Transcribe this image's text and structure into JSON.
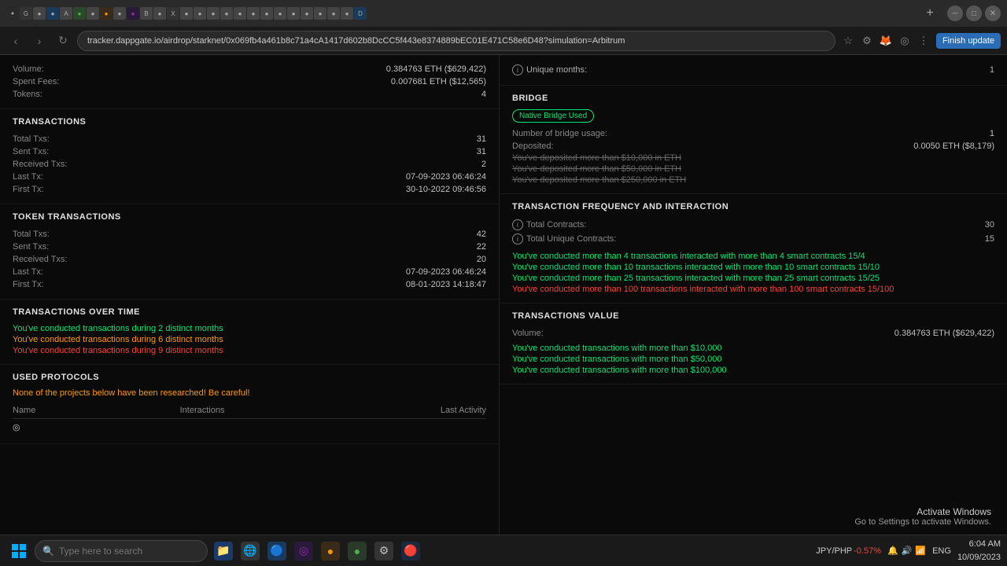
{
  "browser": {
    "tab_title": "tracker.dappgate.io/airdrop/starknet/0x069fb4a461b8c71a4cA1417d602b8DcCC5f443e8374889bEC01E471C58e6D48?simulation=Arbitrum",
    "address": "tracker.dappgate.io/airdrop/starknet/0x069fb4a461b8c71a4cA1417d602b8DcCC5f443e8374889bEC01E471C58e6D48?simulation=Arbitrum",
    "finish_update": "Finish update"
  },
  "left": {
    "volume_label": "Volume:",
    "volume_value": "0.384763 ETH ($629,422)",
    "spent_fees_label": "Spent Fees:",
    "spent_fees_value": "0.007681 ETH ($12,565)",
    "tokens_label": "Tokens:",
    "tokens_value": "4",
    "transactions_title": "TRANSACTIONS",
    "total_txs_label": "Total Txs:",
    "total_txs_value": "31",
    "sent_txs_label": "Sent Txs:",
    "sent_txs_value": "31",
    "received_txs_label": "Received Txs:",
    "received_txs_value": "2",
    "last_tx_label": "Last Tx:",
    "last_tx_value": "07-09-2023 06:46:24",
    "first_tx_label": "First Tx:",
    "first_tx_value": "30-10-2022 09:46:56",
    "token_transactions_title": "TOKEN TRANSACTIONS",
    "token_total_txs_label": "Total Txs:",
    "token_total_txs_value": "42",
    "token_sent_txs_label": "Sent Txs:",
    "token_sent_txs_value": "22",
    "token_received_txs_label": "Received Txs:",
    "token_received_txs_value": "20",
    "token_last_tx_label": "Last Tx:",
    "token_last_tx_value": "07-09-2023 06:46:24",
    "token_first_tx_label": "First Tx:",
    "token_first_tx_value": "08-01-2023 14:18:47",
    "over_time_title": "TRANSACTIONS OVER TIME",
    "over_time_1": "You've conducted transactions during 2 distinct months",
    "over_time_2": "You've conducted transactions during 6 distinct months",
    "over_time_3": "You've conducted transactions during 9 distinct months",
    "protocols_title": "USED PROTOCOLS",
    "protocols_warning": "None of the projects below have been researched! Be careful!",
    "protocols_col_name": "Name",
    "protocols_col_interactions": "Interactions",
    "protocols_col_last_activity": "Last Activity",
    "unique_months_label": "Unique months:",
    "unique_months_value": "1"
  },
  "right": {
    "bridge_title": "BRIDGE",
    "native_bridge_tag": "Native Bridge Used",
    "bridge_usage_label": "Number of bridge usage:",
    "bridge_usage_value": "1",
    "deposited_label": "Deposited:",
    "deposited_value": "0.0050 ETH ($8,179)",
    "bridge_msg_1": "You've deposited more than $10,000 in ETH",
    "bridge_msg_2": "You've deposited more than $50,000 in ETH",
    "bridge_msg_3": "You've deposited more than $250,000 in ETH",
    "tx_freq_title": "TRANSACTION FREQUENCY AND INTERACTION",
    "total_contracts_label": "Total Contracts:",
    "total_contracts_value": "30",
    "total_unique_contracts_label": "Total Unique Contracts:",
    "total_unique_contracts_value": "15",
    "freq_msg_1": "You've conducted more than 4 transactions\ninteracted with more than 4 smart contracts 15/4",
    "freq_msg_2": "You've conducted more than 10 transactions\ninteracted with more than 10 smart contracts 15/10",
    "freq_msg_3": "You've conducted more than 25 transactions\ninteracted with more than 25 smart contracts 15/25",
    "freq_msg_4": "You've conducted more than 100 transactions\ninteracted with more than 100 smart contracts 15/100",
    "tx_value_title": "TRANSACTIONS VALUE",
    "volume_label": "Volume:",
    "volume_value": "0.384763 ETH ($629,422)",
    "value_msg_1": "You've conducted transactions with more than $10,000",
    "value_msg_2": "You've conducted transactions with more than $50,000",
    "value_msg_3": "You've conducted transactions with more than $100,000"
  },
  "taskbar": {
    "search_placeholder": "Type here to search",
    "time": "6:04 AM",
    "date": "10/09/2023",
    "currency": "JPY/PHP",
    "currency_change": "-0.57%",
    "language": "ENG"
  },
  "activate_windows": {
    "title": "Activate Windows",
    "subtitle": "Go to Settings to activate Windows."
  }
}
